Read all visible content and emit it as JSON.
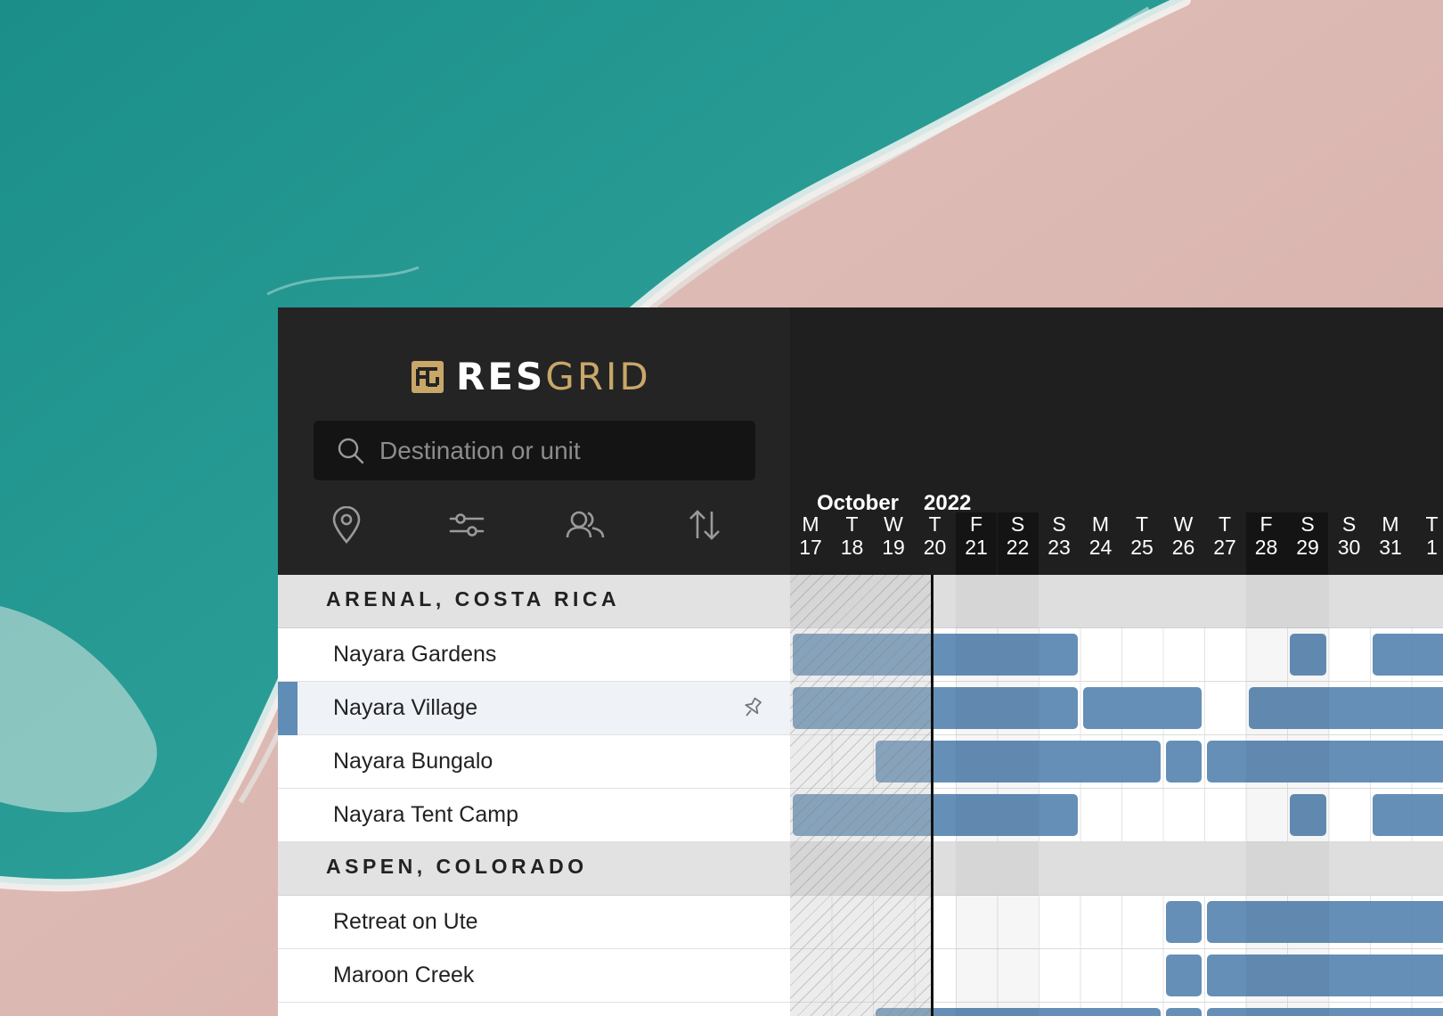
{
  "brand": {
    "name_bold": "RES",
    "name_light": "GRID",
    "gold": "#c9a769"
  },
  "search": {
    "placeholder": "Destination or unit",
    "icon": "search-icon"
  },
  "toolbar": [
    {
      "name": "location-filter-button",
      "icon": "map-pin-icon"
    },
    {
      "name": "filter-settings-button",
      "icon": "sliders-icon"
    },
    {
      "name": "guests-button",
      "icon": "users-icon"
    },
    {
      "name": "sort-button",
      "icon": "sort-arrows-icon"
    }
  ],
  "calendar": {
    "month": "October",
    "year": "2022",
    "days": [
      {
        "dow": "M",
        "day": "17"
      },
      {
        "dow": "T",
        "day": "18"
      },
      {
        "dow": "W",
        "day": "19"
      },
      {
        "dow": "T",
        "day": "20"
      },
      {
        "dow": "F",
        "day": "21"
      },
      {
        "dow": "S",
        "day": "22"
      },
      {
        "dow": "S",
        "day": "23"
      },
      {
        "dow": "M",
        "day": "24"
      },
      {
        "dow": "T",
        "day": "25"
      },
      {
        "dow": "W",
        "day": "26"
      },
      {
        "dow": "T",
        "day": "27"
      },
      {
        "dow": "F",
        "day": "28"
      },
      {
        "dow": "S",
        "day": "29"
      },
      {
        "dow": "S",
        "day": "30"
      },
      {
        "dow": "M",
        "day": "31"
      },
      {
        "dow": "T",
        "day": "1"
      }
    ],
    "today_index": 3,
    "weekend_indices": [
      4,
      5,
      11,
      12
    ]
  },
  "groups": [
    {
      "title": "ARENAL, COSTA RICA",
      "units": [
        {
          "name": "Nayara Gardens",
          "selected": false,
          "bookings": [
            [
              0,
              7
            ],
            [
              12,
              13
            ],
            [
              14,
              16
            ]
          ]
        },
        {
          "name": "Nayara Village",
          "selected": true,
          "pinned": true,
          "bookings": [
            [
              0,
              7
            ],
            [
              7,
              10
            ],
            [
              11,
              16
            ]
          ]
        },
        {
          "name": "Nayara Bungalo",
          "selected": false,
          "bookings": [
            [
              2,
              9
            ],
            [
              9,
              10
            ],
            [
              10,
              16
            ]
          ]
        },
        {
          "name": "Nayara Tent Camp",
          "selected": false,
          "bookings": [
            [
              0,
              7
            ],
            [
              12,
              13
            ],
            [
              14,
              16
            ]
          ]
        }
      ]
    },
    {
      "title": "ASPEN, COLORADO",
      "units": [
        {
          "name": "Retreat on Ute",
          "selected": false,
          "bookings": [
            [
              9,
              10
            ],
            [
              10,
              16
            ]
          ]
        },
        {
          "name": "Maroon Creek",
          "selected": false,
          "bookings": [
            [
              9,
              10
            ],
            [
              10,
              16
            ]
          ]
        },
        {
          "name": "",
          "selected": false,
          "bookings": [
            [
              2,
              9
            ],
            [
              9,
              10
            ],
            [
              10,
              16
            ]
          ]
        }
      ]
    }
  ],
  "colors": {
    "booking": "#5886b0",
    "selected_bar": "#5f8db5",
    "header_bg": "#242424"
  }
}
